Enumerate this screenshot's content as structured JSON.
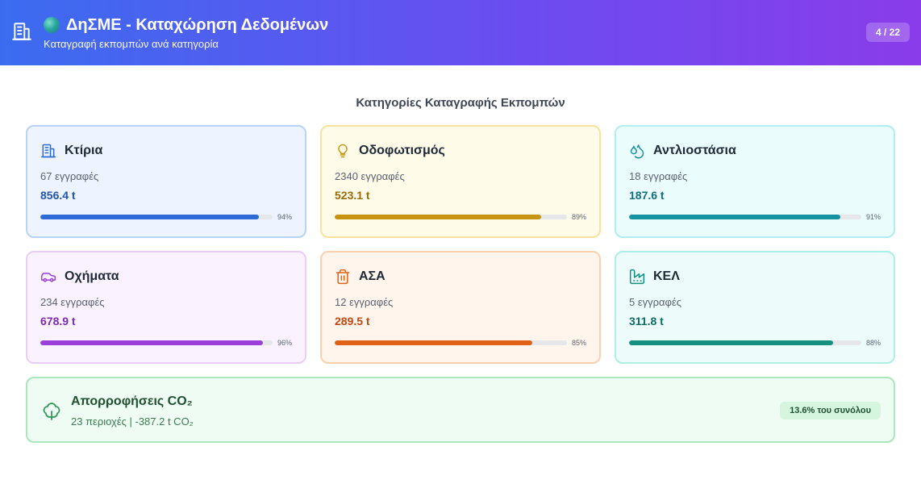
{
  "header": {
    "title": "ΔηΣΜΕ - Καταχώρηση Δεδομένων",
    "subtitle": "Καταγραφή εκπομπών ανά κατηγορία",
    "pager": "4 / 22",
    "icons": [
      "building-icon",
      "globe-icon"
    ]
  },
  "section_title": "Κατηγορίες Καταγραφής Εκπομπών",
  "categories": [
    {
      "name": "Κτίρια",
      "records": "67 εγγραφές",
      "value": "856.4 t",
      "percent": 94,
      "percent_label": "94%",
      "icon": "building-icon",
      "accent": "#2e6bd6",
      "value_color": "#2453b0"
    },
    {
      "name": "Οδοφωτισμός",
      "records": "2340 εγγραφές",
      "value": "523.1 t",
      "percent": 89,
      "percent_label": "89%",
      "icon": "lightbulb-icon",
      "accent": "#c79412",
      "value_color": "#9a6b06"
    },
    {
      "name": "Αντλιοστάσια",
      "records": "18 εγγραφές",
      "value": "187.6 t",
      "percent": 91,
      "percent_label": "91%",
      "icon": "water-drops-icon",
      "accent": "#14929f",
      "value_color": "#0f6f7b"
    },
    {
      "name": "Οχήματα",
      "records": "234 εγγραφές",
      "value": "678.9 t",
      "percent": 96,
      "percent_label": "96%",
      "icon": "car-icon",
      "accent": "#9a3fd9",
      "value_color": "#7c2ab5"
    },
    {
      "name": "ΑΣΑ",
      "records": "12 εγγραφές",
      "value": "289.5 t",
      "percent": 85,
      "percent_label": "85%",
      "icon": "trash-icon",
      "accent": "#e06217",
      "value_color": "#c2490f"
    },
    {
      "name": "ΚΕΛ",
      "records": "5 εγγραφές",
      "value": "311.8 t",
      "percent": 88,
      "percent_label": "88%",
      "icon": "factory-icon",
      "accent": "#14907f",
      "value_color": "#0d6d61"
    }
  ],
  "absorptions": {
    "title": "Απορροφήσεις CO₂",
    "subtitle": "23 περιοχές | -387.2 t CO₂",
    "badge": "13.6% του συνόλου",
    "icon": "tree-icon",
    "accent": "#2d9b56"
  }
}
